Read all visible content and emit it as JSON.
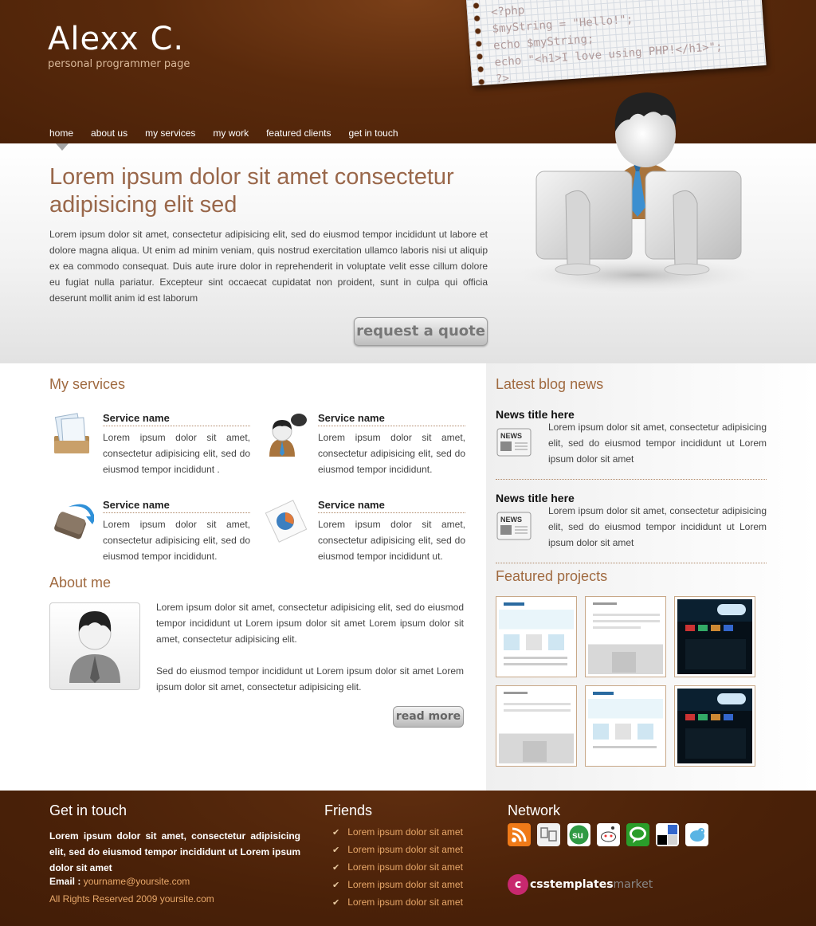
{
  "header": {
    "title": "Alexx C.",
    "subtitle": "personal programmer page",
    "paper_code": [
      "<?php",
      "$myString = \"Hello!\";",
      "echo $myString;",
      "echo \"<h1>I love using PHP!</h1>\";",
      "?>"
    ]
  },
  "nav": {
    "items": [
      "home",
      "about us",
      "my services",
      "my work",
      "featured clients",
      "get in touch"
    ],
    "active": "home"
  },
  "hero": {
    "title": "Lorem ipsum dolor sit amet consectetur adipisicing elit sed",
    "text": "Lorem ipsum dolor sit amet, consectetur adipisicing elit, sed do eiusmod tempor incididunt ut labore et dolore magna aliqua. Ut enim ad minim veniam, quis nostrud exercitation ullamco laboris nisi ut aliquip ex ea commodo consequat. Duis aute irure dolor in reprehenderit in voluptate velit esse cillum dolore eu fugiat nulla pariatur. Excepteur sint occaecat cupidatat non proident, sunt in culpa qui officia deserunt mollit anim id est laborum",
    "button": "request a quote"
  },
  "services": {
    "title": "My services",
    "items": [
      {
        "name": "Service name",
        "text": "Lorem ipsum dolor sit amet, consectetur adipisicing elit, sed do eiusmod tempor incididunt ."
      },
      {
        "name": "Service name",
        "text": "Lorem ipsum dolor sit amet, consectetur adipisicing elit, sed do eiusmod tempor incididunt."
      },
      {
        "name": "Service name",
        "text": "Lorem ipsum dolor sit amet, consectetur adipisicing elit, sed do eiusmod tempor incididunt."
      },
      {
        "name": "Service name",
        "text": "Lorem ipsum dolor sit amet, consectetur adipisicing elit, sed do eiusmod tempor incididunt ut."
      }
    ]
  },
  "about": {
    "title": "About me",
    "p1": "Lorem ipsum dolor sit amet, consectetur adipisicing elit, sed do eiusmod tempor incididunt ut Lorem ipsum dolor sit amet Lorem ipsum dolor sit amet, consectetur adipisicing elit.",
    "p2": "Sed do eiusmod tempor incididunt ut Lorem ipsum dolor sit amet Lorem ipsum dolor sit amet, consectetur adipisicing elit.",
    "button": "read more"
  },
  "blog": {
    "title": "Latest blog news",
    "items": [
      {
        "title": "News title here",
        "text": "Lorem ipsum dolor sit amet, consectetur adipisicing elit, sed do eiusmod tempor incididunt ut Lorem ipsum dolor sit amet",
        "icon_label": "NEWS"
      },
      {
        "title": "News title here",
        "text": "Lorem ipsum dolor sit amet, consectetur adipisicing elit, sed do eiusmod tempor incididunt ut Lorem ipsum dolor sit amet",
        "icon_label": "NEWS"
      }
    ]
  },
  "projects": {
    "title": "Featured projects",
    "thumbs": [
      "light",
      "gray",
      "dark",
      "gray",
      "light",
      "dark"
    ]
  },
  "footer": {
    "contact_title": "Get in touch",
    "contact_text": "Lorem ipsum dolor sit amet, consectetur adipisicing elit, sed do eiusmod tempor incididunt ut Lorem ipsum dolor sit amet",
    "email_label": "Email :",
    "email": "yourname@yoursite.com",
    "copyright": "All Rights Reserved 2009 yoursite.com",
    "friends_title": "Friends",
    "friends": [
      "Lorem ipsum dolor sit amet",
      "Lorem ipsum dolor sit amet",
      "Lorem ipsum dolor sit amet",
      "Lorem ipsum dolor sit amet",
      "Lorem ipsum dolor sit amet"
    ],
    "network_title": "Network",
    "network_icons": [
      "rss-icon",
      "delicious-icon",
      "stumbleupon-icon",
      "reddit-icon",
      "technorati-icon",
      "delicious-squares-icon",
      "twitter-bird-icon"
    ],
    "brand_main": "csstemplates",
    "brand_suffix": "market",
    "brand_letter": "c"
  },
  "colors": {
    "brown": "#4a2108",
    "accent_title": "#a06a40",
    "link_orange": "#e8a86a"
  }
}
